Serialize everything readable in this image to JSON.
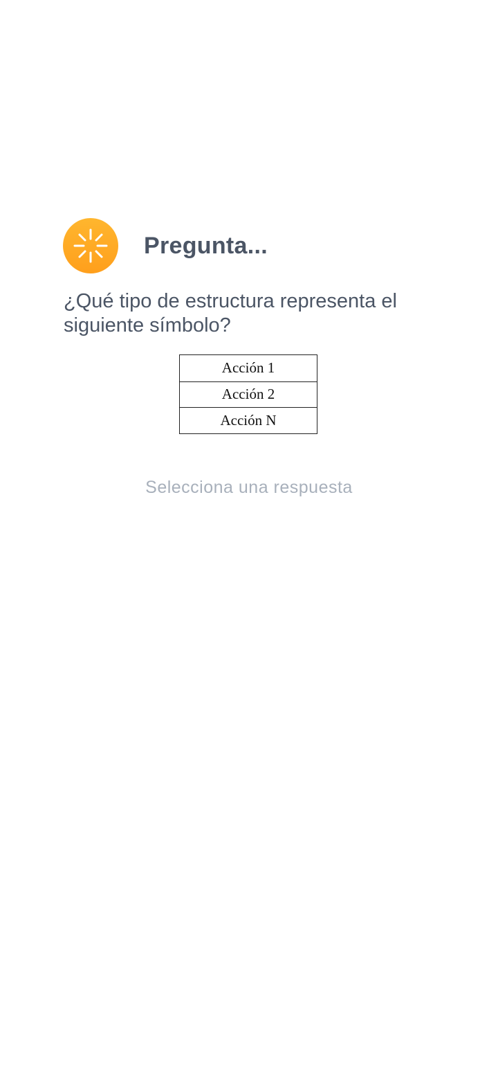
{
  "header": {
    "title": "Pregunta...",
    "icon": "loading-spinner-icon",
    "icon_color": "#ffa726"
  },
  "question": {
    "text": "¿Qué tipo de estructura representa el siguiente símbolo?"
  },
  "symbol": {
    "rows": [
      "Acción 1",
      "Acción 2",
      "Acción N"
    ]
  },
  "answer": {
    "prompt": "Selecciona una respuesta"
  },
  "colors": {
    "title_text": "#4b5565",
    "prompt_text": "#a8b0bb",
    "accent": "#ffa726"
  }
}
